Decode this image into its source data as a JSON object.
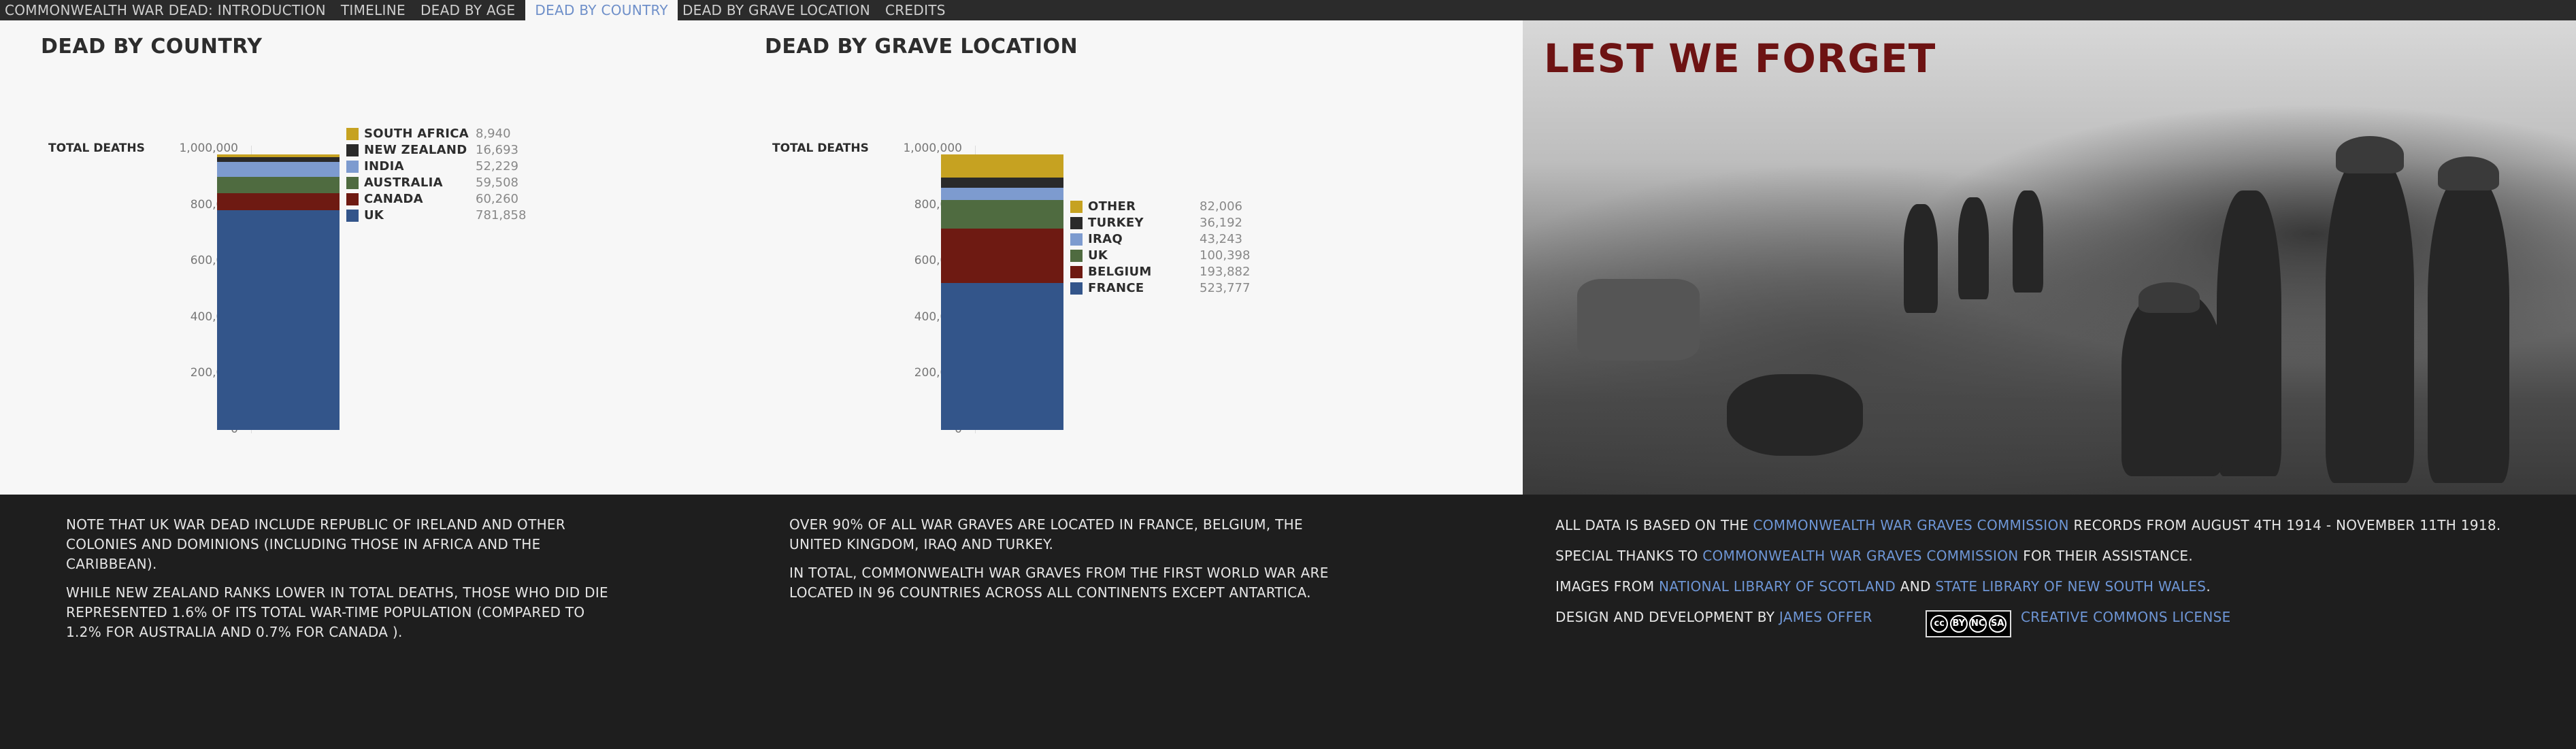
{
  "nav": {
    "tabs": [
      {
        "label": "COMMONWEALTH WAR DEAD: INTRODUCTION",
        "active": false
      },
      {
        "label": "TIMELINE",
        "active": false
      },
      {
        "label": "DEAD BY AGE",
        "active": false
      },
      {
        "label": "DEAD BY COUNTRY",
        "active": true
      },
      {
        "label": "DEAD BY GRAVE LOCATION",
        "active": false
      },
      {
        "label": "CREDITS",
        "active": false
      }
    ]
  },
  "chart_data": [
    {
      "type": "bar",
      "title": "DEAD BY COUNTRY",
      "ylabel": "TOTAL DEATHS",
      "ylim": [
        0,
        1000000
      ],
      "yticks": [
        "1,000,000",
        "800,000",
        "600,000",
        "400,000",
        "200,000",
        "0"
      ],
      "stacked": true,
      "series": [
        {
          "name": "UK",
          "value": 781858,
          "display": "781,858",
          "color": "#33558a"
        },
        {
          "name": "CANADA",
          "value": 60260,
          "display": "60,260",
          "color": "#6e1a12"
        },
        {
          "name": "AUSTRALIA",
          "value": 59508,
          "display": "59,508",
          "color": "#4f6b40"
        },
        {
          "name": "INDIA",
          "value": 52229,
          "display": "52,229",
          "color": "#7d9bcf"
        },
        {
          "name": "NEW ZEALAND",
          "value": 16693,
          "display": "16,693",
          "color": "#2a2a2a"
        },
        {
          "name": "SOUTH AFRICA",
          "value": 8940,
          "display": "8,940",
          "color": "#c6a221"
        }
      ]
    },
    {
      "type": "bar",
      "title": "DEAD BY GRAVE LOCATION",
      "ylabel": "TOTAL DEATHS",
      "ylim": [
        0,
        1000000
      ],
      "yticks": [
        "1,000,000",
        "800,000",
        "600,000",
        "400,000",
        "200,000",
        "0"
      ],
      "stacked": true,
      "series": [
        {
          "name": "FRANCE",
          "value": 523777,
          "display": "523,777",
          "color": "#33558a"
        },
        {
          "name": "BELGIUM",
          "value": 193882,
          "display": "193,882",
          "color": "#6e1a12"
        },
        {
          "name": "UK",
          "value": 100398,
          "display": "100,398",
          "color": "#4f6b40"
        },
        {
          "name": "IRAQ",
          "value": 43243,
          "display": "43,243",
          "color": "#7d9bcf"
        },
        {
          "name": "TURKEY",
          "value": 36192,
          "display": "36,192",
          "color": "#2a2a2a"
        },
        {
          "name": "OTHER",
          "value": 82006,
          "display": "82,006",
          "color": "#c6a221"
        }
      ]
    }
  ],
  "photo": {
    "title": "LEST WE FORGET"
  },
  "notes": {
    "country": [
      "NOTE THAT UK WAR DEAD INCLUDE REPUBLIC OF IRELAND AND OTHER COLONIES AND DOMINIONS (INCLUDING THOSE IN AFRICA AND THE CARIBBEAN).",
      "WHILE NEW ZEALAND RANKS LOWER IN TOTAL DEATHS, THOSE WHO DID DIE REPRESENTED 1.6% OF ITS TOTAL WAR-TIME POPULATION (COMPARED TO 1.2% FOR AUSTRALIA AND 0.7% FOR CANADA )."
    ],
    "grave": [
      "OVER 90% OF ALL WAR GRAVES ARE LOCATED IN FRANCE, BELGIUM, THE UNITED KINGDOM, IRAQ AND TURKEY.",
      "IN TOTAL, COMMONWEALTH WAR GRAVES FROM THE FIRST WORLD WAR ARE LOCATED IN 96 COUNTRIES ACROSS ALL CONTINENTS EXCEPT ANTARTICA."
    ]
  },
  "credits": {
    "line1_pre": "ALL DATA IS BASED ON THE",
    "line1_link": "COMMONWEALTH WAR GRAVES COMMISSION",
    "line1_post": "RECORDS FROM AUGUST 4TH 1914 - NOVEMBER 11TH 1918.",
    "line2_pre": "SPECIAL THANKS TO",
    "line2_link": "COMMONWEALTH WAR GRAVES COMMISSION",
    "line2_post": "FOR THEIR ASSISTANCE.",
    "line3_pre": "IMAGES FROM",
    "line3_link1": "NATIONAL LIBRARY OF SCOTLAND",
    "line3_mid": "AND",
    "line3_link2": "STATE LIBRARY OF NEW SOUTH WALES",
    "line3_post": ".",
    "line4_pre": "DESIGN AND DEVELOPMENT BY",
    "line4_link": "JAMES OFFER",
    "license_link": "CREATIVE COMMONS LICENSE",
    "cc_badge_text": [
      "cc",
      "BY",
      "NC",
      "SA"
    ]
  }
}
